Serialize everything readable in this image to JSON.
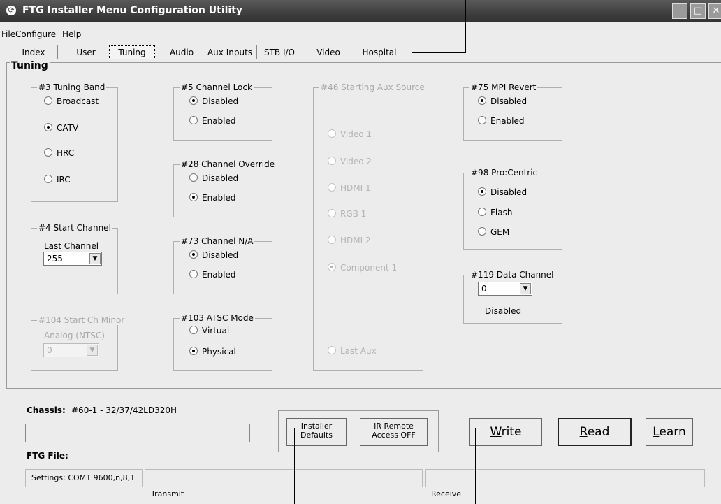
{
  "app": {
    "title": "FTG Installer Menu Configuration Utility",
    "icon": "app-logo-icon"
  },
  "window_controls": {
    "minimize": "_",
    "maximize": "□",
    "close": "✕"
  },
  "menu": [
    {
      "label": "File",
      "accel": "F",
      "rest": "ile"
    },
    {
      "label": "Configure",
      "accel": "C",
      "rest": "onfigure"
    },
    {
      "label": "Help",
      "accel": "H",
      "rest": "elp"
    }
  ],
  "tabs": [
    "Index",
    "User",
    "Tuning",
    "Audio",
    "Aux Inputs",
    "STB I/O",
    "Video",
    "Hospital"
  ],
  "active_tab": "Tuning",
  "panel_title": "Tuning",
  "groups": {
    "tuning_band": {
      "legend": "#3 Tuning Band",
      "options": [
        "Broadcast",
        "CATV",
        "HRC",
        "IRC"
      ],
      "selected": "CATV"
    },
    "start_channel": {
      "legend": "#4 Start Channel",
      "label": "Last Channel",
      "value": "255"
    },
    "start_ch_minor": {
      "legend": "#104 Start Ch Minor",
      "label": "Analog (NTSC)",
      "value": "0",
      "disabled": true
    },
    "channel_lock": {
      "legend": "#5 Channel Lock",
      "options": [
        "Disabled",
        "Enabled"
      ],
      "selected": "Disabled"
    },
    "channel_override": {
      "legend": "#28 Channel Override",
      "options": [
        "Disabled",
        "Enabled"
      ],
      "selected": "Enabled"
    },
    "channel_na": {
      "legend": "#73 Channel N/A",
      "options": [
        "Disabled",
        "Enabled"
      ],
      "selected": "Disabled"
    },
    "atsc_mode": {
      "legend": "#103 ATSC Mode",
      "options": [
        "Virtual",
        "Physical"
      ],
      "selected": "Physical"
    },
    "starting_aux_source": {
      "legend": "#46 Starting Aux Source",
      "options": [
        "Video 1",
        "Video 2",
        "HDMI 1",
        "RGB 1",
        "HDMI 2",
        "Component 1",
        "Last Aux"
      ],
      "selected": "Component 1",
      "disabled": true
    },
    "mpi_revert": {
      "legend": "#75 MPI Revert",
      "options": [
        "Disabled",
        "Enabled"
      ],
      "selected": "Disabled"
    },
    "pro_centric": {
      "legend": "#98 Pro:Centric",
      "options": [
        "Disabled",
        "Flash",
        "GEM"
      ],
      "selected": "Disabled"
    },
    "data_channel": {
      "legend": "#119 Data Channel",
      "value": "0",
      "status": "Disabled"
    }
  },
  "bottom": {
    "chassis_label": "Chassis:",
    "chassis_value": "#60-1 - 32/37/42LD320H",
    "ftg_file_label": "FTG File:",
    "buttons": {
      "installer_defaults": [
        "Installer",
        "Defaults"
      ],
      "ir_remote": [
        "IR Remote",
        "Access OFF"
      ],
      "write": {
        "accel": "W",
        "rest": "rite"
      },
      "read": {
        "accel": "R",
        "rest": "ead"
      },
      "learn": {
        "accel": "L",
        "rest": "earn"
      }
    },
    "settings": "Settings: COM1 9600,n,8,1",
    "transmit_label": "Transmit",
    "receive_label": "Receive"
  }
}
